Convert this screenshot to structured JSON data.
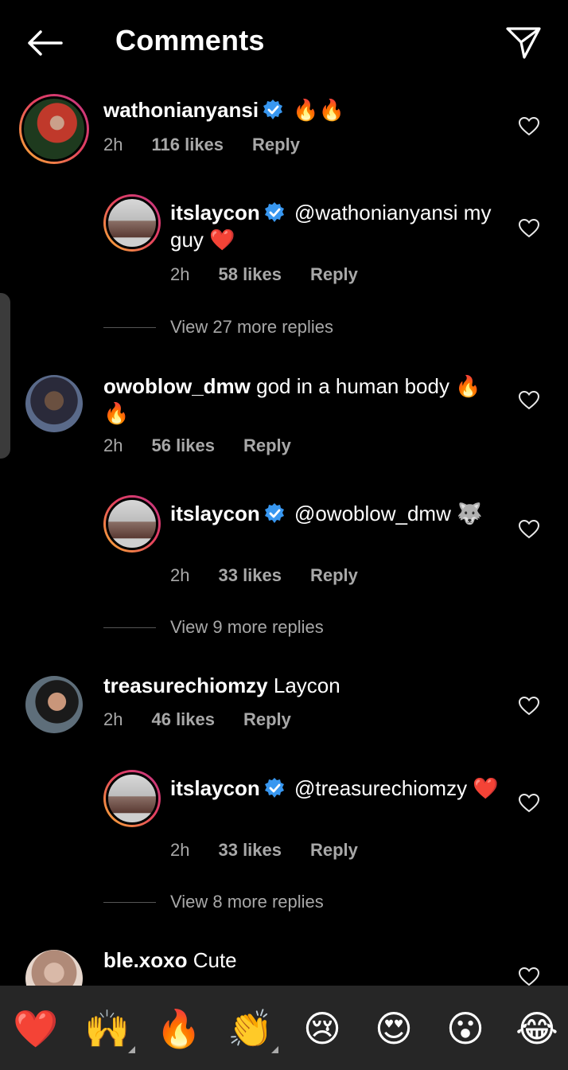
{
  "header": {
    "title": "Comments",
    "back_icon": "back-arrow-icon",
    "send_icon": "paper-plane-icon"
  },
  "comments": [
    {
      "username": "wathonianyansi",
      "verified": true,
      "text": "🔥🔥",
      "time": "2h",
      "likes": "116 likes",
      "reply": "Reply",
      "replies": [
        {
          "username": "itslaycon",
          "verified": true,
          "text": "@wathonianyansi my guy ❤️",
          "time": "2h",
          "likes": "58 likes",
          "reply": "Reply"
        }
      ],
      "view_more": "View 27 more replies"
    },
    {
      "username": "owoblow_dmw",
      "verified": false,
      "text": "god in a human body 🔥🔥",
      "time": "2h",
      "likes": "56 likes",
      "reply": "Reply",
      "replies": [
        {
          "username": "itslaycon",
          "verified": true,
          "text": "@owoblow_dmw 🐺",
          "time": "2h",
          "likes": "33 likes",
          "reply": "Reply"
        }
      ],
      "view_more": "View 9 more replies"
    },
    {
      "username": "treasurechiomzy",
      "verified": false,
      "text": "Laycon",
      "time": "2h",
      "likes": "46 likes",
      "reply": "Reply",
      "replies": [
        {
          "username": "itslaycon",
          "verified": true,
          "text": "@treasurechiomzy ❤️",
          "time": "2h",
          "likes": "33 likes",
          "reply": "Reply"
        }
      ],
      "view_more": "View 8 more replies"
    },
    {
      "username": "ble.xoxo",
      "verified": false,
      "text": "Cute"
    }
  ],
  "emoji_bar": [
    "❤️",
    "🙌",
    "🔥",
    "👏",
    "😢",
    "😍",
    "😮",
    "😂"
  ],
  "colors": {
    "background": "#000000",
    "emoji_bar": "#262626",
    "verified": "#3897f0",
    "meta": "#a8a8a8"
  }
}
